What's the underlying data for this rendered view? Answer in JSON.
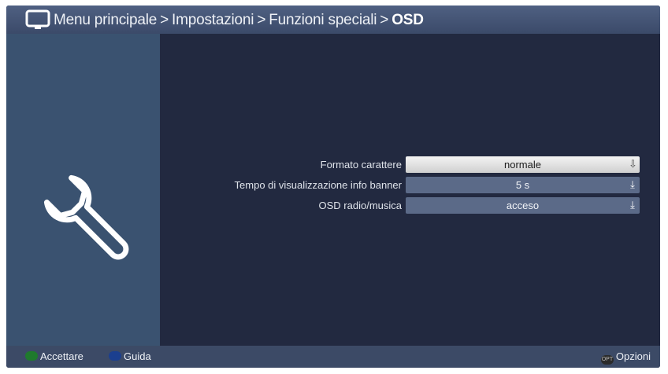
{
  "breadcrumb": {
    "items": [
      "Menu principale",
      "Impostazioni",
      "Funzioni speciali"
    ],
    "separator": ">",
    "current": "OSD"
  },
  "icons": {
    "header": "tv-icon",
    "sidebar": "wrench-icon"
  },
  "settings": [
    {
      "label": "Formato carattere",
      "value": "normale",
      "selected": true
    },
    {
      "label": "Tempo di visualizzazione info banner",
      "value": "5 s",
      "selected": false
    },
    {
      "label": "OSD radio/musica",
      "value": "acceso",
      "selected": false
    }
  ],
  "footer": {
    "accept_label": "Accettare",
    "guide_label": "Guida",
    "options_label": "Opzioni",
    "options_key_text": "OPT"
  },
  "colors": {
    "accept": "#1f7a2d",
    "guide": "#1b3f8f",
    "background": "#232941",
    "sidebar": "#3a5270"
  }
}
